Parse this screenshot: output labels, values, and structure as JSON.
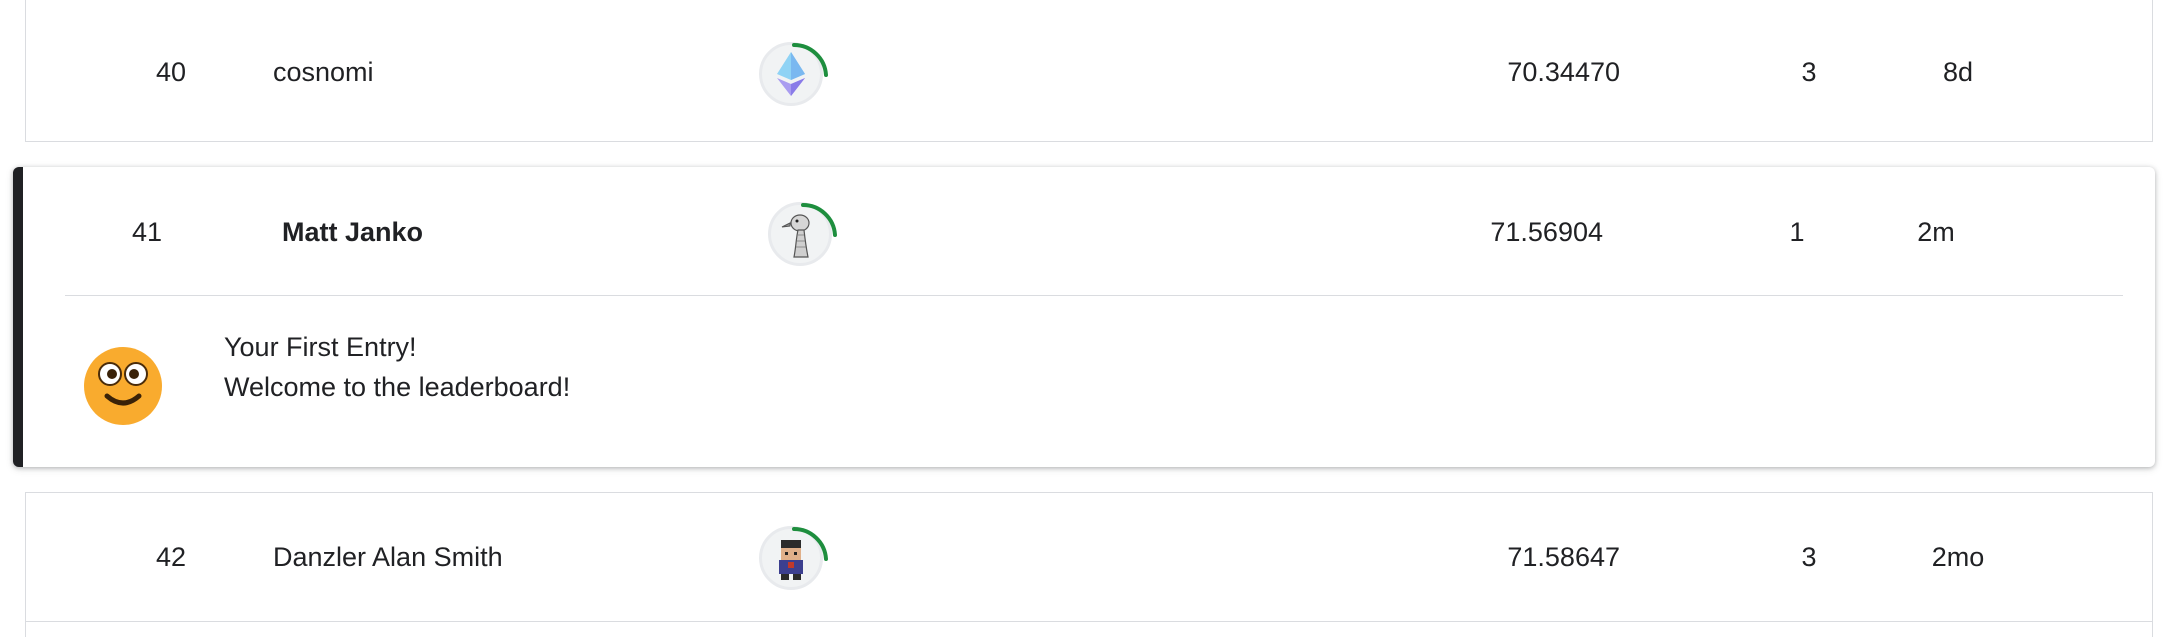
{
  "rows": [
    {
      "rank": "40",
      "name": "cosnomi",
      "avatar_icon": "ethereum-logo-icon",
      "score": "70.34470",
      "entries": "3",
      "last": "8d"
    },
    {
      "rank": "41",
      "name": "Matt Janko",
      "avatar_icon": "ostrich-sketch-icon",
      "score": "71.56904",
      "entries": "1",
      "last": "2m"
    },
    {
      "rank": "42",
      "name": "Danzler Alan Smith",
      "avatar_icon": "pixel-character-icon",
      "score": "71.58647",
      "entries": "3",
      "last": "2mo"
    }
  ],
  "first_entry": {
    "title": "Your First Entry!",
    "subtitle": "Welcome to the leaderboard!",
    "icon": "smiley-face-icon"
  },
  "colors": {
    "progress_ring": "#1e8e3e",
    "highlight_border": "#202124",
    "emoji_face": "#f9ab2e"
  }
}
